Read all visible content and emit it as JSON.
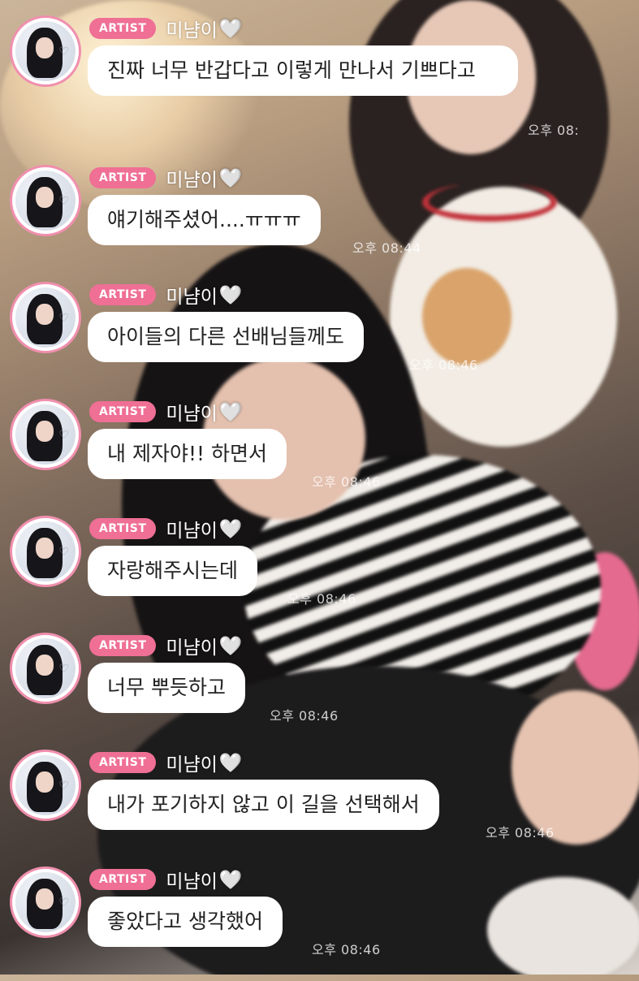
{
  "messages": [
    {
      "badge": "ARTIST",
      "name": "미냠이",
      "text": "진짜 너무 반갑다고 이렇게 만나서 기쁘다고",
      "time": "오후 08:"
    },
    {
      "badge": "ARTIST",
      "name": "미냠이",
      "text": "얘기해주셨어....ㅠㅠㅠ",
      "time": "오후 08:44"
    },
    {
      "badge": "ARTIST",
      "name": "미냠이",
      "text": "아이들의 다른 선배님들께도",
      "time": "오후 08:46"
    },
    {
      "badge": "ARTIST",
      "name": "미냠이",
      "text": "내 제자야!! 하면서",
      "time": "오후 08:46"
    },
    {
      "badge": "ARTIST",
      "name": "미냠이",
      "text": "자랑해주시는데",
      "time": "오후 08:46"
    },
    {
      "badge": "ARTIST",
      "name": "미냠이",
      "text": "너무 뿌듯하고",
      "time": "오후 08:46"
    },
    {
      "badge": "ARTIST",
      "name": "미냠이",
      "text": "내가 포기하지 않고 이 길을 선택해서",
      "time": "오후 08:46"
    },
    {
      "badge": "ARTIST",
      "name": "미냠이",
      "text": "좋았다고 생각했어",
      "time": "오후 08:46"
    }
  ],
  "icons": {
    "heart": "white-heart-icon",
    "avatar": "artist-avatar"
  },
  "colors": {
    "badge": "#ef6f95",
    "avatar_ring": "#f08fae",
    "bubble": "#ffffff"
  }
}
